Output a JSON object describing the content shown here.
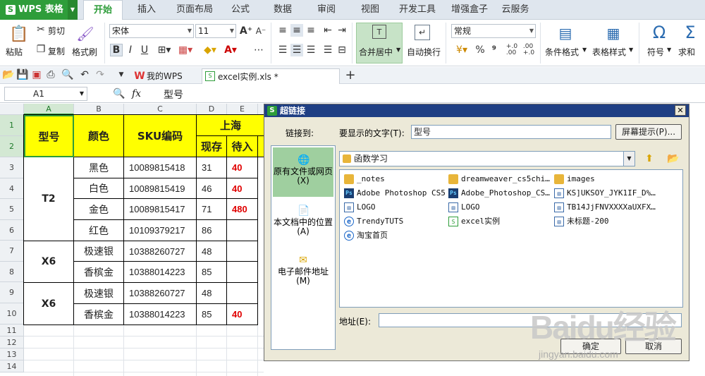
{
  "app": {
    "name": "WPS 表格"
  },
  "menu_tabs": [
    "开始",
    "插入",
    "页面布局",
    "公式",
    "数据",
    "审阅",
    "视图",
    "开发工具",
    "增强盒子",
    "云服务"
  ],
  "ribbon": {
    "paste": "粘贴",
    "cut": "剪切",
    "copy": "复制",
    "format_painter": "格式刷",
    "font_name": "宋体",
    "font_size": "11",
    "merge_center": "合并居中",
    "wrap_text": "自动换行",
    "number_format": "常规",
    "conditional_format": "条件格式",
    "table_style": "表格样式",
    "symbol": "符号",
    "sum": "求和"
  },
  "doc_tabs": {
    "home": "我的WPS",
    "file": "excel实例.xls *"
  },
  "formula_bar": {
    "cell_ref": "A1",
    "fx": "fx",
    "content": "型号"
  },
  "sheet": {
    "columns": [
      "A",
      "B",
      "C",
      "D",
      "E"
    ],
    "rows": [
      "1",
      "2",
      "3",
      "4",
      "5",
      "6",
      "7",
      "8",
      "9",
      "10",
      "11",
      "12",
      "13",
      "14"
    ],
    "headers": {
      "model": "型号",
      "color": "颜色",
      "sku": "SKU编码",
      "city": "上海",
      "stock": "现存",
      "pending": "待入"
    },
    "groups": [
      "T2",
      "X6",
      "X6"
    ],
    "data": [
      {
        "color": "黑色",
        "sku": "10089815418",
        "stock": "31",
        "pending": "40"
      },
      {
        "color": "白色",
        "sku": "10089815419",
        "stock": "46",
        "pending": "40"
      },
      {
        "color": "金色",
        "sku": "10089815417",
        "stock": "71",
        "pending": "480"
      },
      {
        "color": "红色",
        "sku": "10109379217",
        "stock": "86",
        "pending": ""
      },
      {
        "color": "极速银",
        "sku": "10388260727",
        "stock": "48",
        "pending": ""
      },
      {
        "color": "香槟金",
        "sku": "10388014223",
        "stock": "85",
        "pending": ""
      },
      {
        "color": "极速银",
        "sku": "10388260727",
        "stock": "48",
        "pending": ""
      },
      {
        "color": "香槟金",
        "sku": "10388014223",
        "stock": "85",
        "pending": "40"
      }
    ]
  },
  "dialog": {
    "title": "超链接",
    "link_to": "链接到:",
    "display_text_label": "要显示的文字(T):",
    "display_text_value": "型号",
    "screen_tip": "屏幕提示(P)...",
    "link_options": [
      "原有文件或网页(X)",
      "本文档中的位置(A)",
      "电子邮件地址(M)"
    ],
    "folder": "函数学习",
    "files": [
      {
        "name": "_notes",
        "type": "folder"
      },
      {
        "name": "dreamweaver_cs5chi…",
        "type": "folder"
      },
      {
        "name": "images",
        "type": "folder"
      },
      {
        "name": "Adobe Photoshop CS5",
        "type": "ps"
      },
      {
        "name": "Adobe_Photoshop_CS…",
        "type": "ps"
      },
      {
        "name": "KS]UKSOY_JYK1IF_D%…",
        "type": "doc"
      },
      {
        "name": "LOGO",
        "type": "doc"
      },
      {
        "name": "LOGO",
        "type": "doc"
      },
      {
        "name": "TB14JjFNVXXXXaUXFX…",
        "type": "doc"
      },
      {
        "name": "TrendyTUTS",
        "type": "ie"
      },
      {
        "name": "excel实例",
        "type": "xls"
      },
      {
        "name": "未标题-200",
        "type": "doc"
      },
      {
        "name": "淘宝首页",
        "type": "ie"
      }
    ],
    "address_label": "地址(E):",
    "address_value": "",
    "ok": "确定",
    "cancel": "取消"
  },
  "watermark": {
    "brand": "Baidu经验",
    "url": "jingyan.baidu.com"
  }
}
